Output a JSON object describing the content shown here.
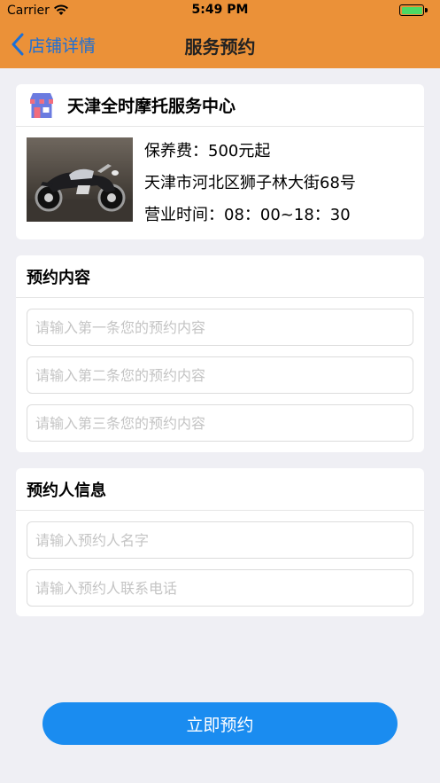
{
  "status": {
    "carrier": "Carrier",
    "time": "5:49 PM"
  },
  "nav": {
    "back_label": "店铺详情",
    "title": "服务预约"
  },
  "shop": {
    "name": "天津全时摩托服务中心",
    "fee": "保养费：500元起",
    "address": "天津市河北区狮子林大街68号",
    "hours": "营业时间：08：00~18：30",
    "image": "motorcycle-photo"
  },
  "content_section": {
    "title": "预约内容",
    "placeholders": [
      "请输入第一条您的预约内容",
      "请输入第二条您的预约内容",
      "请输入第三条您的预约内容"
    ]
  },
  "person_section": {
    "title": "预约人信息",
    "name_placeholder": "请输入预约人名字",
    "phone_placeholder": "请输入预约人联系电话"
  },
  "submit_label": "立即预约",
  "colors": {
    "nav_bg": "#eb9138",
    "accent_blue": "#1a8cf0",
    "back_blue": "#1a6fd8",
    "page_bg": "#efeff4"
  }
}
